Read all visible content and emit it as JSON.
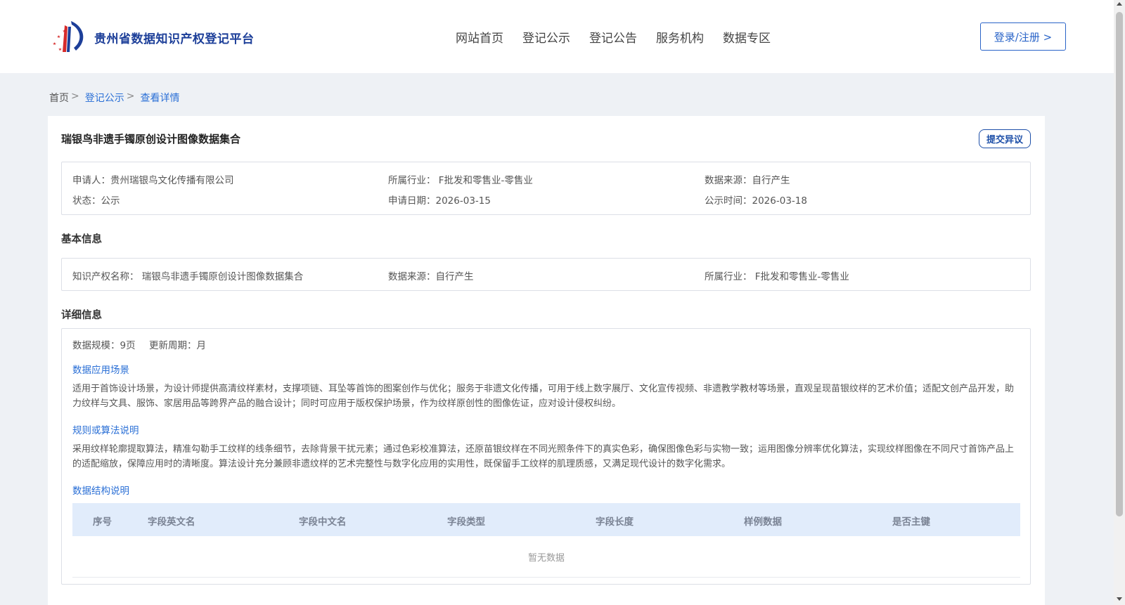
{
  "header": {
    "logo_text": "贵州省数据知识产权登记平台",
    "nav": [
      "网站首页",
      "登记公示",
      "登记公告",
      "服务机构",
      "数据专区"
    ],
    "login_label": "登录/注册 >"
  },
  "breadcrumb": {
    "home": "首页",
    "sep": ">",
    "list": "登记公示",
    "current": "查看详情"
  },
  "record": {
    "title": "瑞银鸟非遗手镯原创设计图像数据集合",
    "objection_label": "提交异议",
    "applicant": "申请人：贵州瑞银鸟文化传播有限公司",
    "industry": "所属行业： F批发和零售业-零售业",
    "data_source": "数据来源：自行产生",
    "status": "状态：公示",
    "apply_date": "申请日期：2026-03-15",
    "publish_date": "公示时间：2026-03-18"
  },
  "basic_info": {
    "section_title": "基本信息",
    "ip_name": "知识产权名称： 瑞银鸟非遗手镯原创设计图像数据集合",
    "data_source": "数据来源：自行产生",
    "industry": "所属行业： F批发和零售业-零售业"
  },
  "detail_info": {
    "section_title": "详细信息",
    "scale": "数据规模：9页",
    "update_cycle": "更新周期：月",
    "scenario_title": "数据应用场景",
    "scenario_text": "适用于首饰设计场景，为设计师提供高清纹样素材，支撑项链、耳坠等首饰的图案创作与优化；服务于非遗文化传播，可用于线上数字展厅、文化宣传视频、非遗教学教材等场景，直观呈现苗银纹样的艺术价值；适配文创产品开发，助力纹样与文具、服饰、家居用品等跨界产品的融合设计；同时可应用于版权保护场景，作为纹样原创性的图像佐证，应对设计侵权纠纷。",
    "algorithm_title": "规则或算法说明",
    "algorithm_text": "采用纹样轮廓提取算法，精准勾勒手工纹样的线条细节，去除背景干扰元素；通过色彩校准算法，还原苗银纹样在不同光照条件下的真实色彩，确保图像色彩与实物一致；运用图像分辨率优化算法，实现纹样图像在不同尺寸首饰产品上的适配缩放，保障应用时的清晰度。算法设计充分兼顾非遗纹样的艺术完整性与数字化应用的实用性，既保留手工纹样的肌理质感，又满足现代设计的数字化需求。",
    "structure_title": "数据结构说明",
    "table_headers": [
      "序号",
      "字段英文名",
      "字段中文名",
      "字段类型",
      "字段长度",
      "样例数据",
      "是否主键"
    ],
    "empty_text": "暂无数据"
  }
}
